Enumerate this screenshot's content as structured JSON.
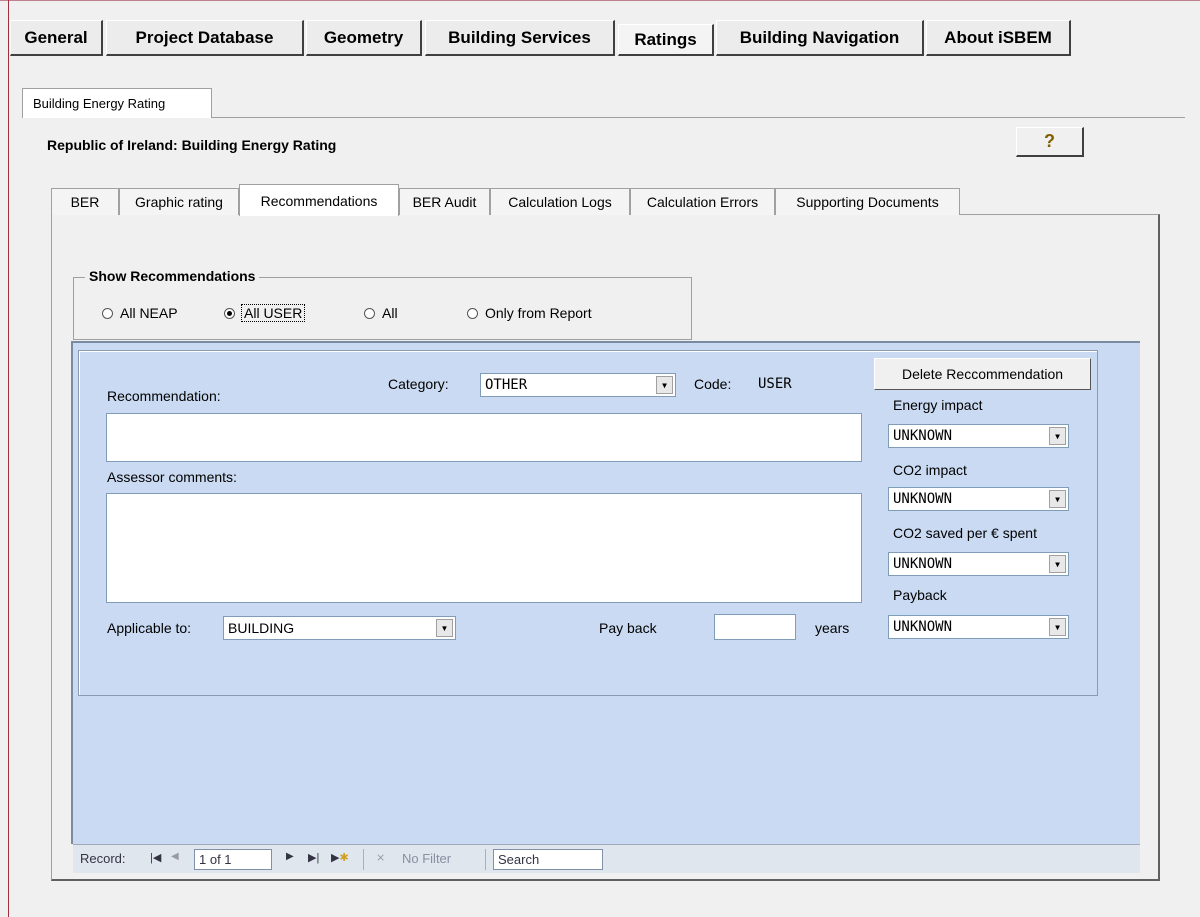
{
  "main_tabs": [
    {
      "label": "General"
    },
    {
      "label": "Project Database"
    },
    {
      "label": "Geometry"
    },
    {
      "label": "Building Services"
    },
    {
      "label": "Ratings"
    },
    {
      "label": "Building Navigation"
    },
    {
      "label": "About iSBEM"
    }
  ],
  "page_tab": "Building Energy Rating",
  "heading": "Republic of Ireland: Building Energy Rating",
  "help_icon": "?",
  "sub_tabs": [
    {
      "label": "BER"
    },
    {
      "label": "Graphic rating"
    },
    {
      "label": "Recommendations"
    },
    {
      "label": "BER Audit"
    },
    {
      "label": "Calculation Logs"
    },
    {
      "label": "Calculation Errors"
    },
    {
      "label": "Supporting Documents"
    }
  ],
  "show_recommendations": {
    "legend": "Show Recommendations",
    "options": [
      "All NEAP",
      "All USER",
      "All",
      "Only from Report"
    ],
    "selected": "All USER"
  },
  "form": {
    "recommendation_label": "Recommendation:",
    "recommendation_value": "",
    "category_label": "Category:",
    "category_value": "OTHER",
    "code_label": "Code:",
    "code_value": "USER",
    "delete_button": "Delete Reccommendation",
    "assessor_label": "Assessor comments:",
    "assessor_value": "",
    "applicable_label": "Applicable to:",
    "applicable_value": "BUILDING",
    "payback_label": "Pay back",
    "payback_value": "",
    "years_label": "years",
    "energy_impact_label": "Energy impact",
    "energy_impact_value": "UNKNOWN",
    "co2_impact_label": "CO2 impact",
    "co2_impact_value": "UNKNOWN",
    "co2_saved_label": "CO2 saved per € spent",
    "co2_saved_value": "UNKNOWN",
    "payback_right_label": "Payback",
    "payback_right_value": "UNKNOWN"
  },
  "navigator": {
    "record_label": "Record:",
    "current": "1 of 1",
    "filter": "No Filter",
    "search": "Search"
  }
}
